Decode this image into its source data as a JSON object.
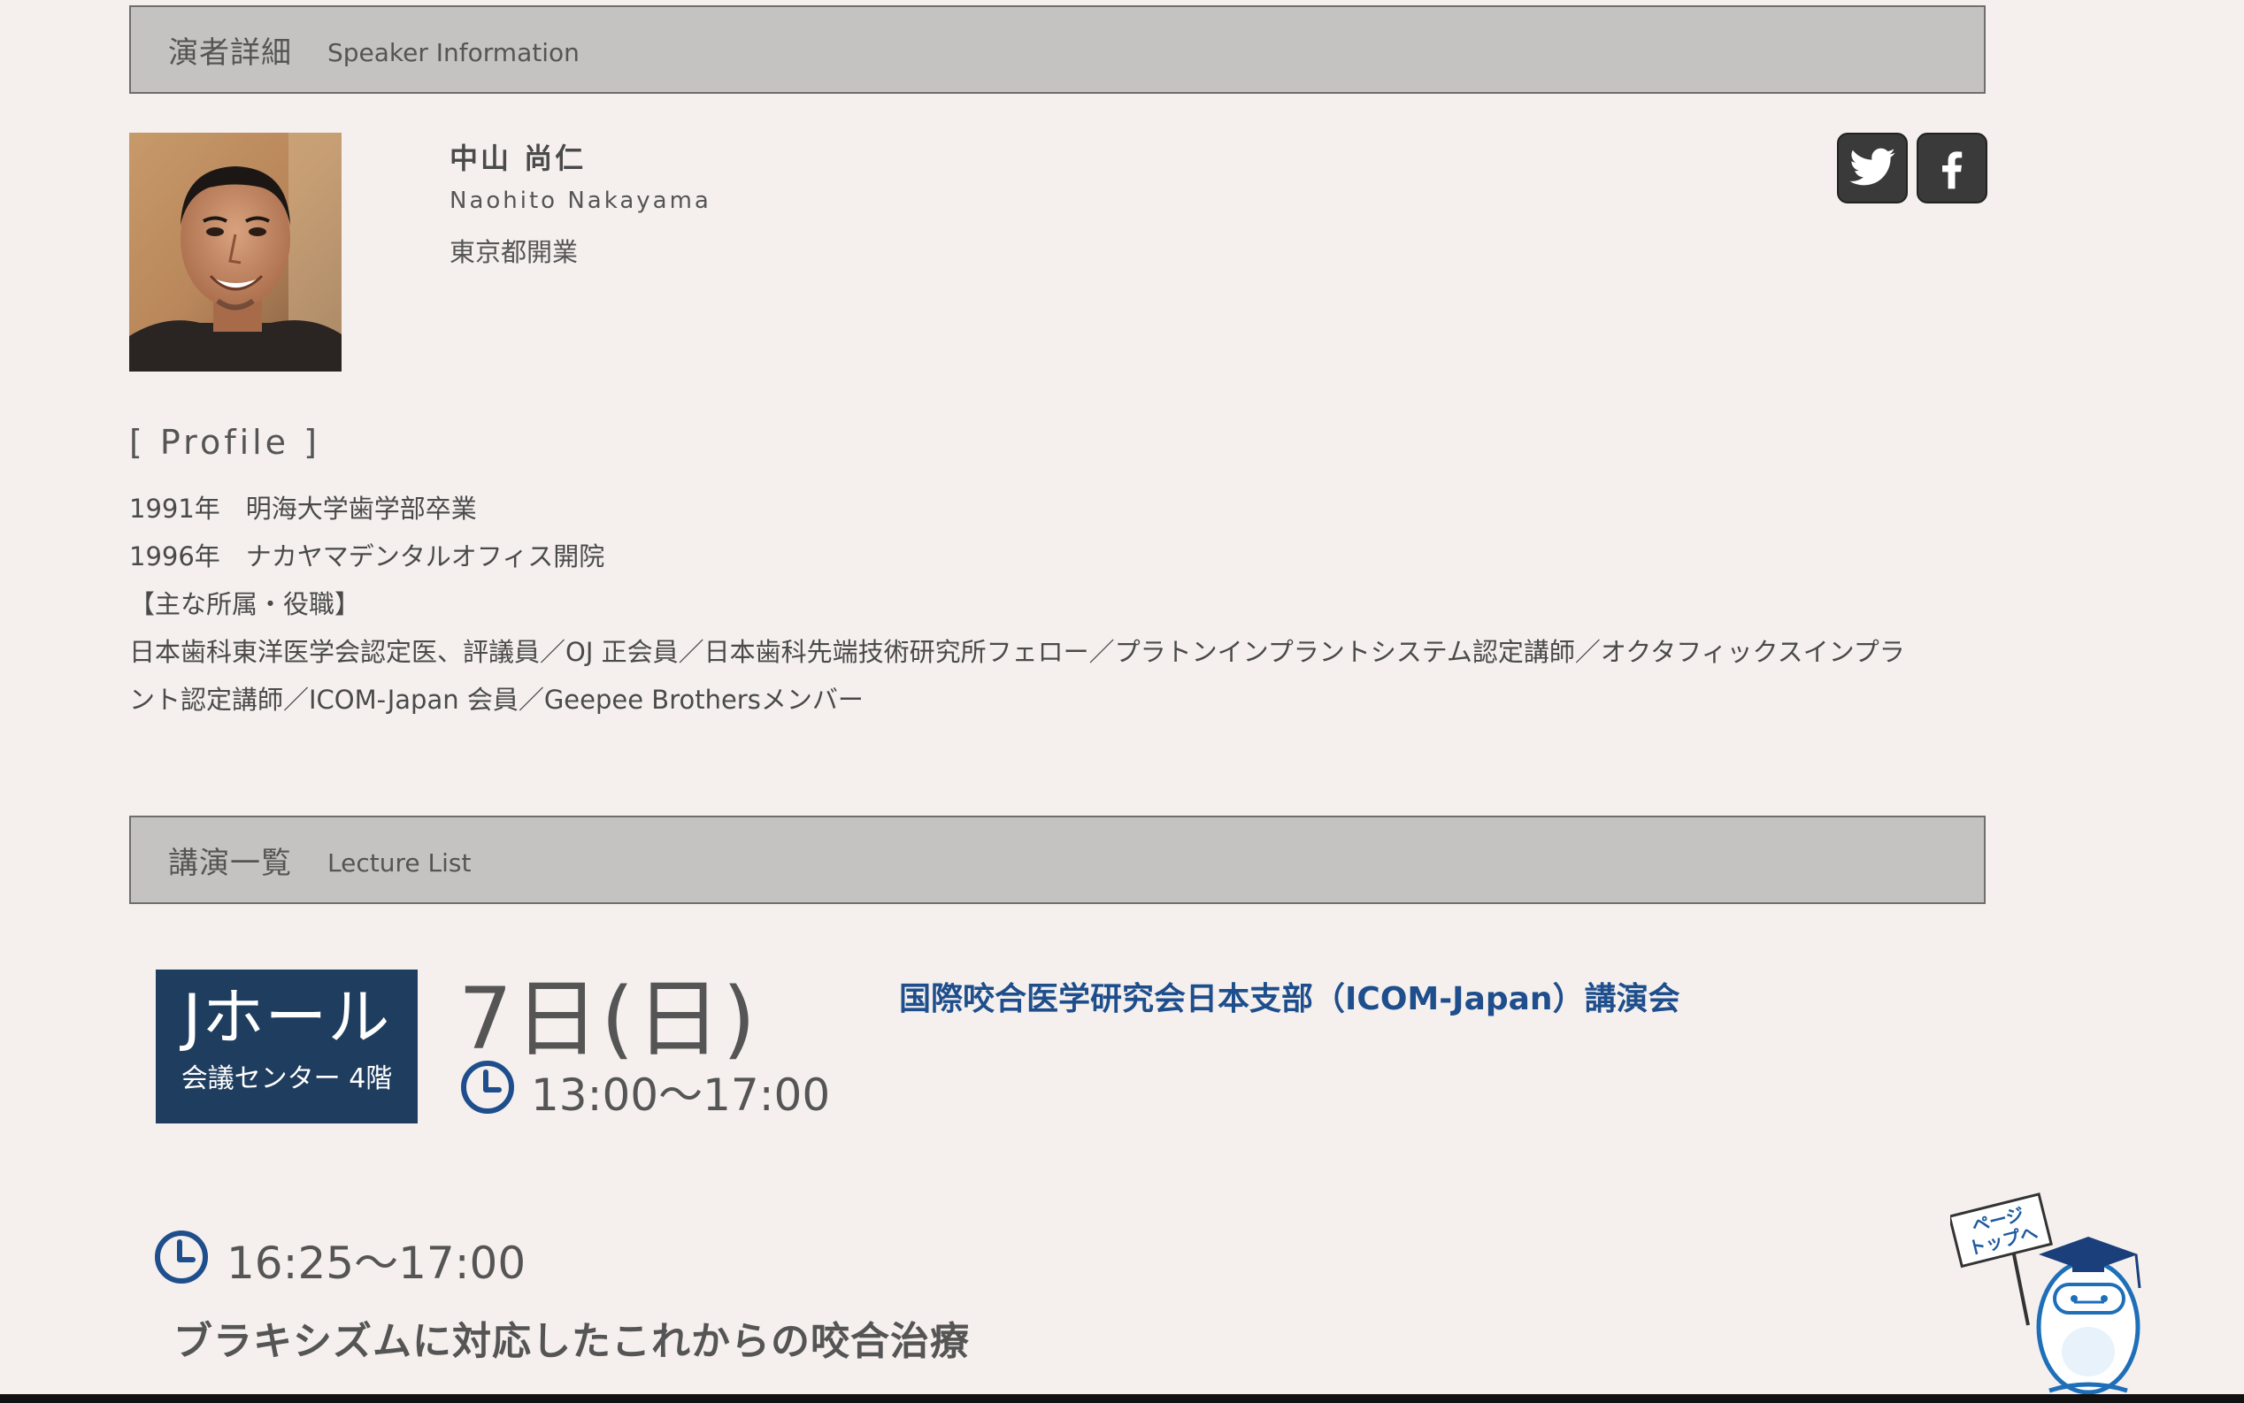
{
  "speaker_section": {
    "title_jp": "演者詳細",
    "title_en": "Speaker Information"
  },
  "speaker": {
    "name_jp": "中山 尚仁",
    "name_en": "Naohito Nakayama",
    "clinic": "東京都開業"
  },
  "social": {
    "twitter_icon": "twitter-icon",
    "facebook_icon": "facebook-icon"
  },
  "profile": {
    "heading": "[ Profile ]",
    "lines": [
      "1991年　明海大学歯学部卒業",
      "1996年　ナカヤマデンタルオフィス開院",
      "【主な所属・役職】",
      "日本歯科東洋医学会認定医、評議員／OJ 正会員／日本歯科先端技術研究所フェロー／プラトンインプラントシステム認定講師／オクタフィックスインプラ",
      "ント認定講師／ICOM-Japan 会員／Geepee Brothersメンバー"
    ]
  },
  "lecture_section": {
    "title_jp": "講演一覧",
    "title_en": "Lecture List"
  },
  "lecture": {
    "hall": "Jホール",
    "floor": "会議センター 4階",
    "date": "7日(日)",
    "session_time": "13:00〜17:00",
    "event": "国際咬合医学研究会日本支部（ICOM-Japan）講演会",
    "talk_time": "16:25〜17:00",
    "title": "ブラキシズムに対応したこれからの咬合治療"
  },
  "page_top": {
    "sign_text": "ページトップへ"
  },
  "colors": {
    "header_bg": "#c4c3c1",
    "hall_bg": "#1f3d5f",
    "link": "#1e4e8c",
    "clock": "#1e4e8c",
    "page_bg": "#f5f0ee"
  }
}
